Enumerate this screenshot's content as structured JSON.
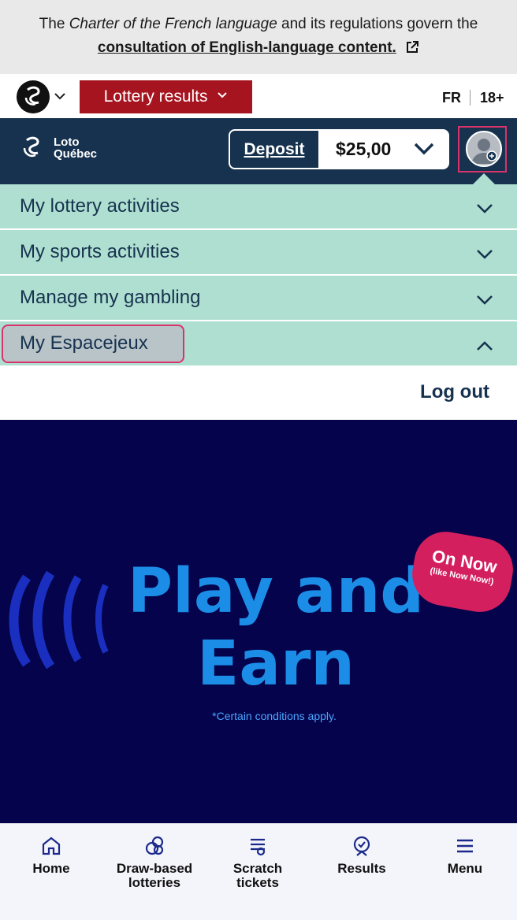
{
  "notice": {
    "text_prefix": "The ",
    "text_italic": "Charter of the French language",
    "text_suffix": " and its regulations govern the",
    "link": "consultation of English-language content."
  },
  "topbar": {
    "lottery_button": "Lottery results",
    "lang": "FR",
    "age": "18+"
  },
  "header": {
    "logo_line1": "Loto",
    "logo_line2": "Québec",
    "deposit": "Deposit",
    "balance": "$25,00"
  },
  "menu": {
    "items": [
      {
        "label": "My lottery activities"
      },
      {
        "label": "My sports activities"
      },
      {
        "label": "Manage my gambling"
      },
      {
        "label": "My Espacejeux"
      }
    ],
    "logout": "Log out"
  },
  "promo": {
    "title_line1": "Play and",
    "title_line2": "Earn",
    "badge_line1": "On Now",
    "badge_line2": "(like Now Now!)",
    "disclaimer": "*Certain conditions apply."
  },
  "bottom_nav": [
    {
      "label_line1": "Home",
      "label_line2": "",
      "icon": "home-icon"
    },
    {
      "label_line1": "Draw-based",
      "label_line2": "lotteries",
      "icon": "lottery-balls-icon"
    },
    {
      "label_line1": "Scratch",
      "label_line2": "tickets",
      "icon": "scratch-ticket-icon"
    },
    {
      "label_line1": "Results",
      "label_line2": "",
      "icon": "results-icon"
    },
    {
      "label_line1": "Menu",
      "label_line2": "",
      "icon": "hamburger-icon"
    }
  ],
  "colors": {
    "navy": "#17324f",
    "lottery_red": "#a5141f",
    "menu_mint": "#aedfd0",
    "promo_bg": "#05034b",
    "promo_blue": "#1b8de6",
    "badge_pink": "#d41f5f",
    "focus_pink": "#d8336b"
  }
}
